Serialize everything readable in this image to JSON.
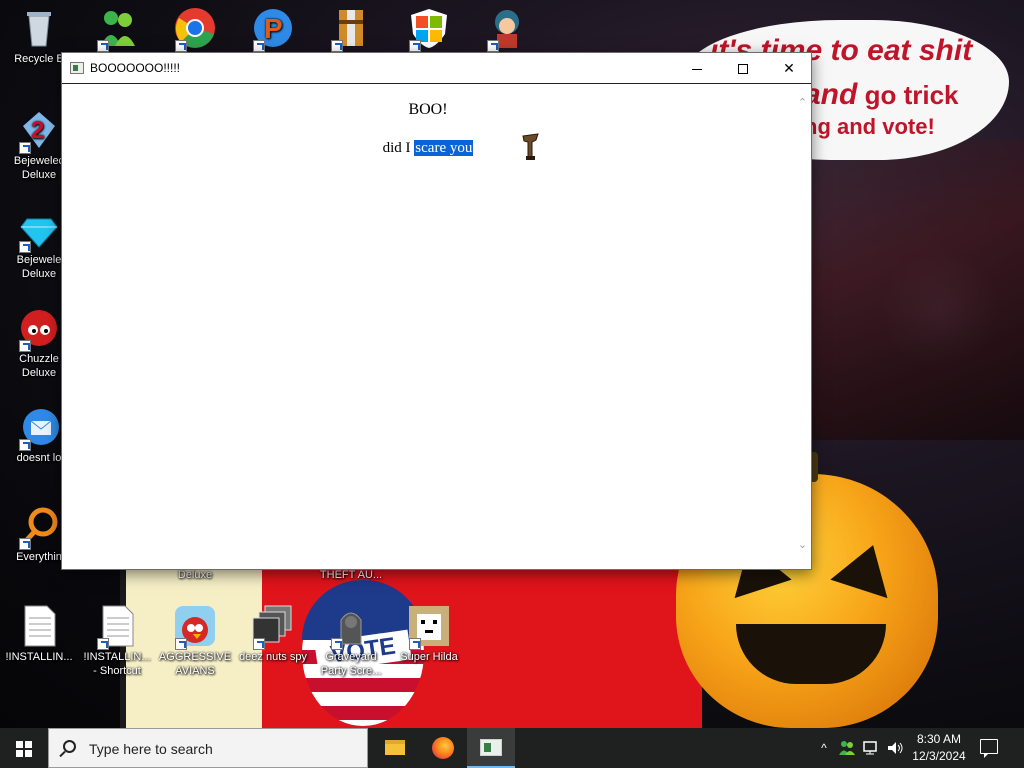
{
  "desktop": {
    "wallpaper_text": {
      "line1": "it's time to eat shit",
      "line2_big": "and",
      "line2_rest": "go trick",
      "line3": "ng and vote!"
    },
    "badge_text": "VOTE",
    "icons": [
      {
        "name": "recycle-bin",
        "label": "Recycle B",
        "icon": "recycle-bin-icon",
        "color": "#9fb3c8"
      },
      {
        "name": "messenger",
        "label": "",
        "icon": "messenger-icon",
        "color": "#3bb54a"
      },
      {
        "name": "chrome",
        "label": "",
        "icon": "chrome-icon",
        "color": "#e33b2e"
      },
      {
        "name": "p-app",
        "label": "",
        "icon": "p-logo-icon",
        "color": "#e05a1a"
      },
      {
        "name": "archive",
        "label": "",
        "icon": "archive-icon",
        "color": "#d08a2a"
      },
      {
        "name": "windows-shield",
        "label": "",
        "icon": "windows-shield-icon",
        "color": "#2b7de0"
      },
      {
        "name": "anime-character",
        "label": "",
        "icon": "character-icon",
        "color": "#2a6f8a"
      },
      {
        "name": "bejeweled-2",
        "label": "Bejewelec\nDeluxe",
        "icon": "bejeweled-2-icon",
        "color": "#c8102e"
      },
      {
        "name": "bejeweled",
        "label": "Bejewele\nDeluxe",
        "icon": "diamond-icon",
        "color": "#22c5ef"
      },
      {
        "name": "chuzzle",
        "label": "Chuzzle\nDeluxe",
        "icon": "chuzzle-icon",
        "color": "#d11f1f"
      },
      {
        "name": "doesnt-load",
        "label": "doesnt lo",
        "icon": "thunderbird-icon",
        "color": "#2e8ae6"
      },
      {
        "name": "everything",
        "label": "Everythin",
        "icon": "everything-search-icon",
        "color": "#f08a1a"
      },
      {
        "name": "deluxe-hidden",
        "label": "Deluxe",
        "icon": "",
        "color": ""
      },
      {
        "name": "theft-auto",
        "label": "THEFT AU...",
        "icon": "",
        "color": ""
      },
      {
        "name": "installing-1",
        "label": "!INSTALLIN...",
        "icon": "text-file-icon",
        "color": "#ffffff"
      },
      {
        "name": "installing-2",
        "label": "!INSTALLIN...\n- Shortcut",
        "icon": "text-file-icon",
        "color": "#ffffff"
      },
      {
        "name": "aggressive-avians",
        "label": "AGGRESSIVE\nAVIANS",
        "icon": "angry-bird-icon",
        "color": "#d62828"
      },
      {
        "name": "deez-nuts-spy",
        "label": "deez nuts spy",
        "icon": "windows-stack-icon",
        "color": "#444444"
      },
      {
        "name": "graveyard-party",
        "label": "Graveyard\nParty Scre...",
        "icon": "graveyard-icon",
        "color": "#555555"
      },
      {
        "name": "super-hilda",
        "label": "Super Hilda",
        "icon": "pixel-dog-icon",
        "color": "#c9b07a"
      }
    ]
  },
  "window": {
    "title": "BOOOOOOO!!!!!",
    "heading": "BOO!",
    "line_prefix": "did I",
    "line_selected": "scare you",
    "controls": {
      "minimize": "minimize",
      "maximize": "maximize",
      "close": "✕"
    }
  },
  "taskbar": {
    "search_placeholder": "Type here to search",
    "time": "8:30 AM",
    "date": "12/3/2024",
    "tray_chevron": "^",
    "apps": [
      "file-explorer",
      "firefox",
      "boo-window"
    ]
  }
}
